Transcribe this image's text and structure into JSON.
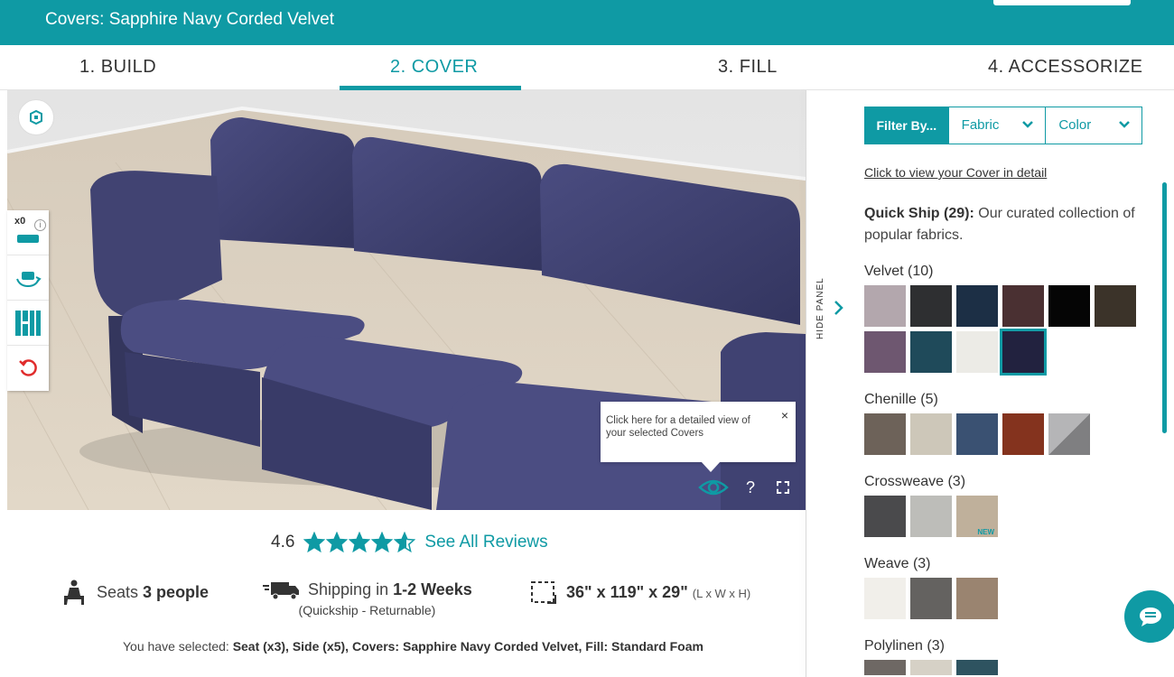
{
  "header": {
    "title": "Covers: Sapphire Navy Corded Velvet"
  },
  "steps": [
    {
      "label": "1. BUILD"
    },
    {
      "label": "2. COVER"
    },
    {
      "label": "3. FILL"
    },
    {
      "label": "4. ACCESSORIZE"
    }
  ],
  "viewer": {
    "seat_count": "x0",
    "info_glyph": "i",
    "tooltip_text": "Click here for a detailed view of your selected Covers",
    "tooltip_close": "×",
    "help_glyph": "?"
  },
  "rating": {
    "value": "4.6",
    "stars_filled": 4.6,
    "reviews_link": "See All Reviews"
  },
  "features": {
    "seats_prefix": "Seats ",
    "seats_value": "3 people",
    "shipping_prefix": "Shipping in ",
    "shipping_value": "1-2 Weeks",
    "shipping_sub": "(Quickship - Returnable)",
    "dimensions": "36\" x 119\" x 29\"",
    "dimensions_unit": "(L x W x H)"
  },
  "selection": {
    "prefix": "You have selected: ",
    "value": "Seat (x3), Side (x5), Covers: Sapphire Navy Corded Velvet, Fill: Standard Foam"
  },
  "panel": {
    "hide_label": "HIDE PANEL",
    "filter_by": "Filter By...",
    "filter_fabric": "Fabric",
    "filter_color": "Color",
    "cover_detail_link": "Click to view your Cover in detail",
    "quickship_title": "Quick Ship (29):",
    "quickship_desc": " Our curated collection of popular fabrics.",
    "new_badge": "NEW",
    "groups": [
      {
        "title": "Velvet (10)",
        "swatches": [
          "#b3a7ad",
          "#2e2f31",
          "#1c2f45",
          "#4a3032",
          "#050505",
          "#3b3329",
          "#6e5770",
          "#1f4a5a",
          "#ecebe6",
          "#22223f"
        ]
      },
      {
        "title": "Chenille (5)",
        "swatches": [
          "#6d6259",
          "#cdc7b9",
          "#3a5172",
          "#84331e",
          "#a7a7a9"
        ]
      },
      {
        "title": "Crossweave (3)",
        "swatches": [
          "#4a4a4c",
          "#bdbdb9",
          "#bfb09b"
        ]
      },
      {
        "title": "Weave (3)",
        "swatches": [
          "#f1efea",
          "#646260",
          "#9a8470"
        ]
      },
      {
        "title": "Polylinen (3)",
        "swatches": [
          "#6e6864",
          "#d6d1c6",
          "#2e5360"
        ]
      }
    ]
  },
  "colors": {
    "accent": "#0f9aa4",
    "sofa": "#3d3f6e"
  }
}
